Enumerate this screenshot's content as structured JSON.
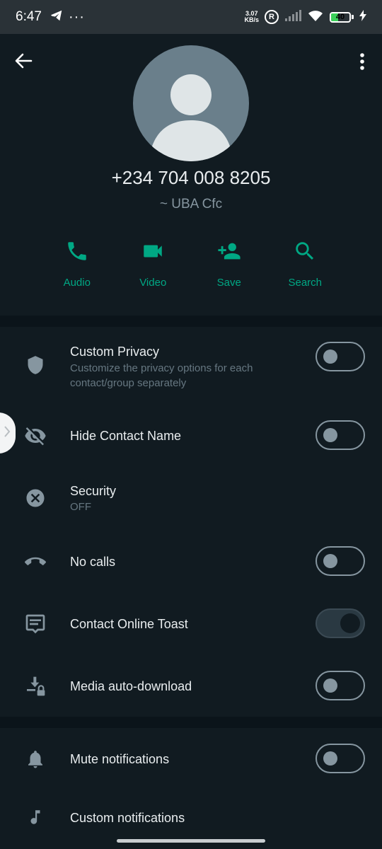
{
  "status_bar": {
    "time": "6:47",
    "net_speed_value": "3.07",
    "net_speed_unit": "KB/s",
    "r_badge": "R",
    "battery": "40"
  },
  "contact": {
    "phone": "+234 704 008 8205",
    "push_name": "~ UBA Cfc"
  },
  "actions": [
    "Audio",
    "Video",
    "Save",
    "Search"
  ],
  "settings": {
    "custom_privacy": {
      "title": "Custom Privacy",
      "subtitle": "Customize the privacy options for each contact/group separately",
      "enabled": false
    },
    "hide_contact_name": {
      "title": "Hide Contact Name",
      "enabled": false
    },
    "security": {
      "title": "Security",
      "subtitle": "OFF"
    },
    "no_calls": {
      "title": "No calls",
      "enabled": false
    },
    "contact_online_toast": {
      "title": "Contact Online Toast",
      "enabled": true
    },
    "media_auto_download": {
      "title": "Media auto-download",
      "enabled": false
    }
  },
  "notifications": {
    "mute": {
      "title": "Mute notifications",
      "enabled": false
    },
    "custom": {
      "title": "Custom notifications"
    }
  },
  "colors": {
    "accent": "#00a884",
    "background": "#0b141a",
    "surface": "#111b21",
    "muted": "#8696a0"
  },
  "icons": [
    "back-arrow-icon",
    "more-vert-icon",
    "phone-icon",
    "video-icon",
    "add-person-icon",
    "search-icon",
    "shield-icon",
    "eye-off-icon",
    "close-circle-icon",
    "call-end-icon",
    "message-icon",
    "download-lock-icon",
    "bell-icon",
    "music-note-icon"
  ]
}
